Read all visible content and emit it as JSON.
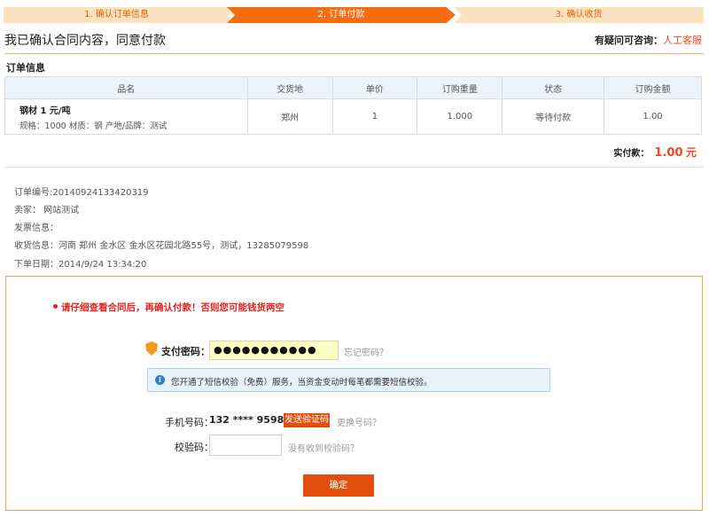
{
  "steps": [
    {
      "label": "1. 确认订单信息"
    },
    {
      "label": "2. 订单付款"
    },
    {
      "label": "3. 确认收货"
    }
  ],
  "header": {
    "title": "我已确认合同内容，同意付款",
    "help_question": "有疑问可咨询：",
    "help_link": "人工客服"
  },
  "order": {
    "section_title": "订单信息",
    "columns": [
      "品名",
      "交货地",
      "单价",
      "订购重量",
      "状态",
      "订购金额"
    ],
    "row": {
      "name": "钢材 1 元/吨",
      "spec": "规格：1000  材质：钢  产地/品牌：测试",
      "location": "郑州",
      "price": "1",
      "weight": "1.000",
      "status": "等待付款",
      "amount": "1.00"
    },
    "total_label": "实付款：",
    "total_value": "1.00",
    "total_unit": "元"
  },
  "details": {
    "order_no": "订单编号:20140924133420319",
    "seller": "卖家：  网站测试",
    "invoice": "发票信息：",
    "shipping": "收货信息：河南 郑州 金水区 金水区花园北路55号，测试，13285079598",
    "date": "下单日期：2014/9/24 13:34:20"
  },
  "payment": {
    "warning": "请仔细查看合同后，再确认付款！否则您可能钱货两空",
    "password_label": "支付密码：",
    "password_value": "●●●●●●●●●●●",
    "forgot": "忘记密码？",
    "notice_icon": "i",
    "notice": "您开通了短信校验（免费）服务，当资金变动时每笔都需要短信校验。",
    "phone_label": "手机号码：",
    "phone_value": "132 **** 9598",
    "send_code": "发送验证码",
    "change_phone": "更换号码？",
    "code_label": "校验码：",
    "code_placeholder": "",
    "no_code": "没有收到校验码？",
    "confirm": "确定"
  }
}
